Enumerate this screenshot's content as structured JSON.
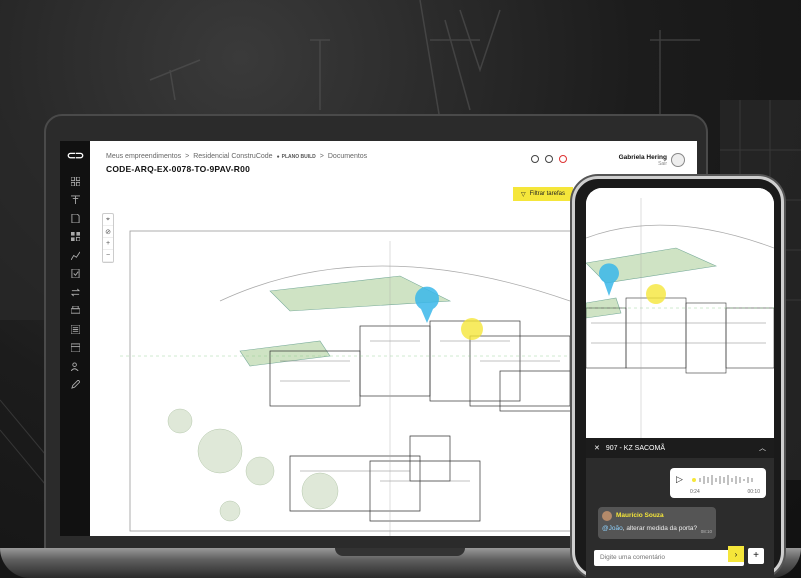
{
  "app": {
    "logo_text": "⊂⊃",
    "breadcrumb": [
      "Meus empreendimentos",
      ">",
      "Residencial ConstruCode",
      "PLANO BUILD",
      ">",
      "Documentos"
    ],
    "title": "CODE-ARQ-EX-0078-TO-9PAV-R00",
    "filter_button": "Filtrar tarefas",
    "user": {
      "name": "Gabriela Hering",
      "sub": "Sair"
    },
    "map_tools": [
      "⌖",
      "⊘",
      "+",
      "−"
    ],
    "sidebar_icons": [
      "grid-icon",
      "filter-icon",
      "document-icon",
      "apps-icon",
      "chart-icon",
      "checklist-icon",
      "sync-icon",
      "printer-icon",
      "list-icon",
      "calendar-icon",
      "users-icon",
      "edit-icon"
    ]
  },
  "phone": {
    "chat_title": "907 - KZ SACOMÃ",
    "audio": {
      "elapsed": "0:24",
      "total": "00:10"
    },
    "message": {
      "author": "Maurício Souza",
      "mention": "@João",
      "text": ", alterar medida da porta?",
      "time": "08:10"
    },
    "comment_placeholder": "Digite uma comentário",
    "send_label": "›",
    "add_label": "+"
  },
  "colors": {
    "accent": "#f5e63a",
    "pin_blue": "#39b7ea",
    "pin_yellow": "#f5e63a",
    "dark": "#111111"
  }
}
